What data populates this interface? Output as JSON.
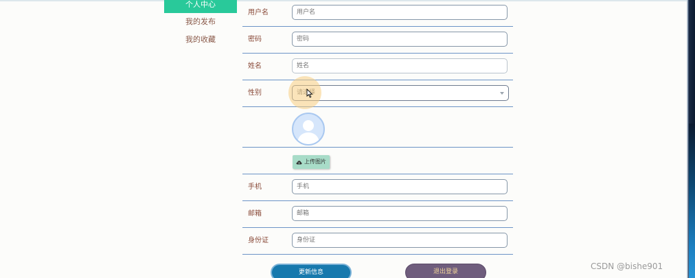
{
  "sidebar": {
    "items": [
      {
        "label": "个人中心",
        "active": true
      },
      {
        "label": "我的发布",
        "active": false
      },
      {
        "label": "我的收藏",
        "active": false
      }
    ]
  },
  "form": {
    "username": {
      "label": "用户名",
      "placeholder": "用户名"
    },
    "password": {
      "label": "密码",
      "placeholder": "密码"
    },
    "name": {
      "label": "姓名",
      "placeholder": "姓名"
    },
    "gender": {
      "label": "性别",
      "placeholder": "请选择"
    },
    "avatar": {
      "upload_label": "上传图片"
    },
    "phone": {
      "label": "手机",
      "placeholder": "手机"
    },
    "email": {
      "label": "邮箱",
      "placeholder": "邮箱"
    },
    "id_card": {
      "label": "身份证",
      "placeholder": "身份证"
    }
  },
  "actions": {
    "update_label": "更新信息",
    "logout_label": "退出登录"
  },
  "watermark": "CSDN @bishe901",
  "colors": {
    "sidebar_active": "#29c99a",
    "row_border": "#6b93c6",
    "update_button": "#1779ad",
    "logout_button": "#6f5d7d",
    "upload_button": "#a8dcc8"
  },
  "icons": {
    "avatar": "avatar-placeholder-icon",
    "upload": "cloud-upload-icon",
    "select": "chevron-down-icon",
    "pointer": "mouse-pointer-icon"
  }
}
